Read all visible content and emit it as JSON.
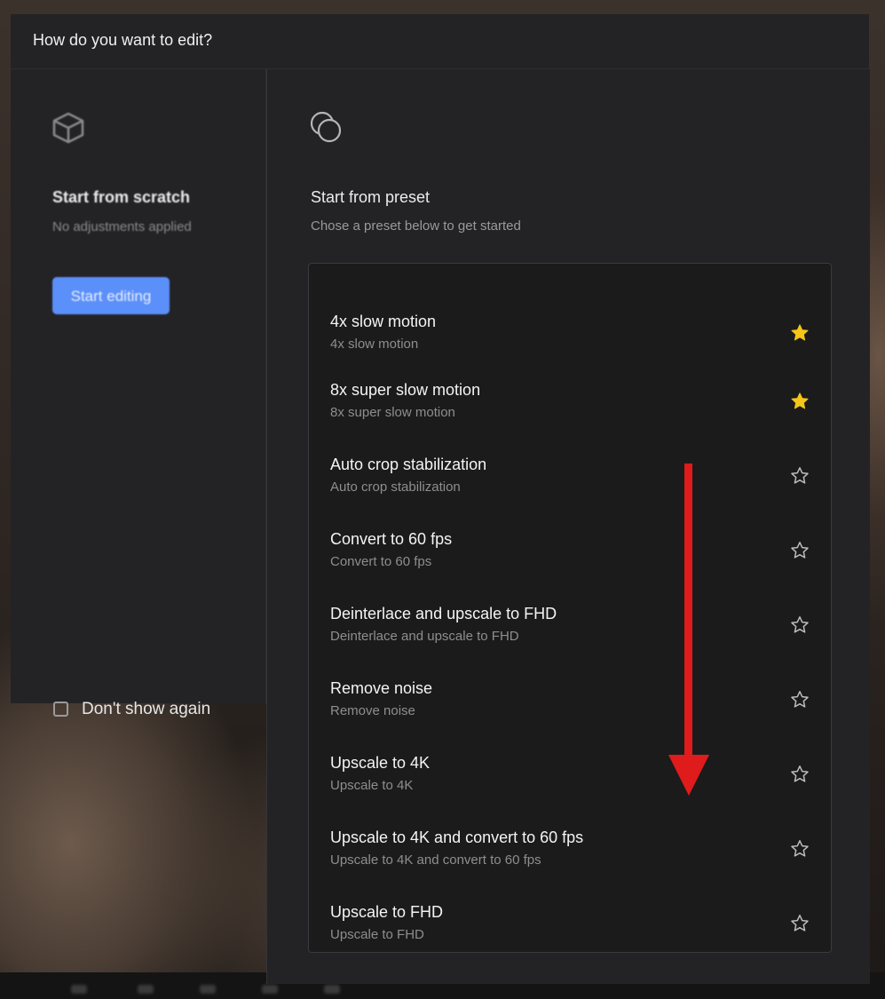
{
  "dialog": {
    "title": "How do you want to edit?"
  },
  "scratch": {
    "icon": "cube-icon",
    "title": "Start from scratch",
    "subtitle": "No adjustments applied",
    "button_label": "Start editing",
    "accent_color": "#5b8ff9"
  },
  "dont_show_again": {
    "label": "Don't show again",
    "checked": false
  },
  "preset": {
    "icon": "overlapping-circles-icon",
    "title": "Start from preset",
    "subtitle": "Chose a preset below to get started",
    "items": [
      {
        "title": "4x slow motion",
        "subtitle": "4x slow motion",
        "favorite": true
      },
      {
        "title": "8x super slow motion",
        "subtitle": "8x super slow motion",
        "favorite": true
      },
      {
        "title": "Auto crop stabilization",
        "subtitle": "Auto crop stabilization",
        "favorite": false
      },
      {
        "title": "Convert to 60 fps",
        "subtitle": "Convert to 60 fps",
        "favorite": false
      },
      {
        "title": "Deinterlace and upscale to FHD",
        "subtitle": "Deinterlace and upscale to FHD",
        "favorite": false
      },
      {
        "title": "Remove noise",
        "subtitle": "Remove noise",
        "favorite": false
      },
      {
        "title": "Upscale to 4K",
        "subtitle": "Upscale to 4K",
        "favorite": false
      },
      {
        "title": "Upscale to 4K and convert to 60 fps",
        "subtitle": "Upscale to 4K and convert to 60 fps",
        "favorite": false
      },
      {
        "title": "Upscale to FHD",
        "subtitle": "Upscale to FHD",
        "favorite": false
      }
    ],
    "favorite_color": "#f5c518",
    "star_outline_color": "#bdbdbd"
  },
  "annotation": {
    "arrow_color": "#e01b1b",
    "direction": "down"
  }
}
